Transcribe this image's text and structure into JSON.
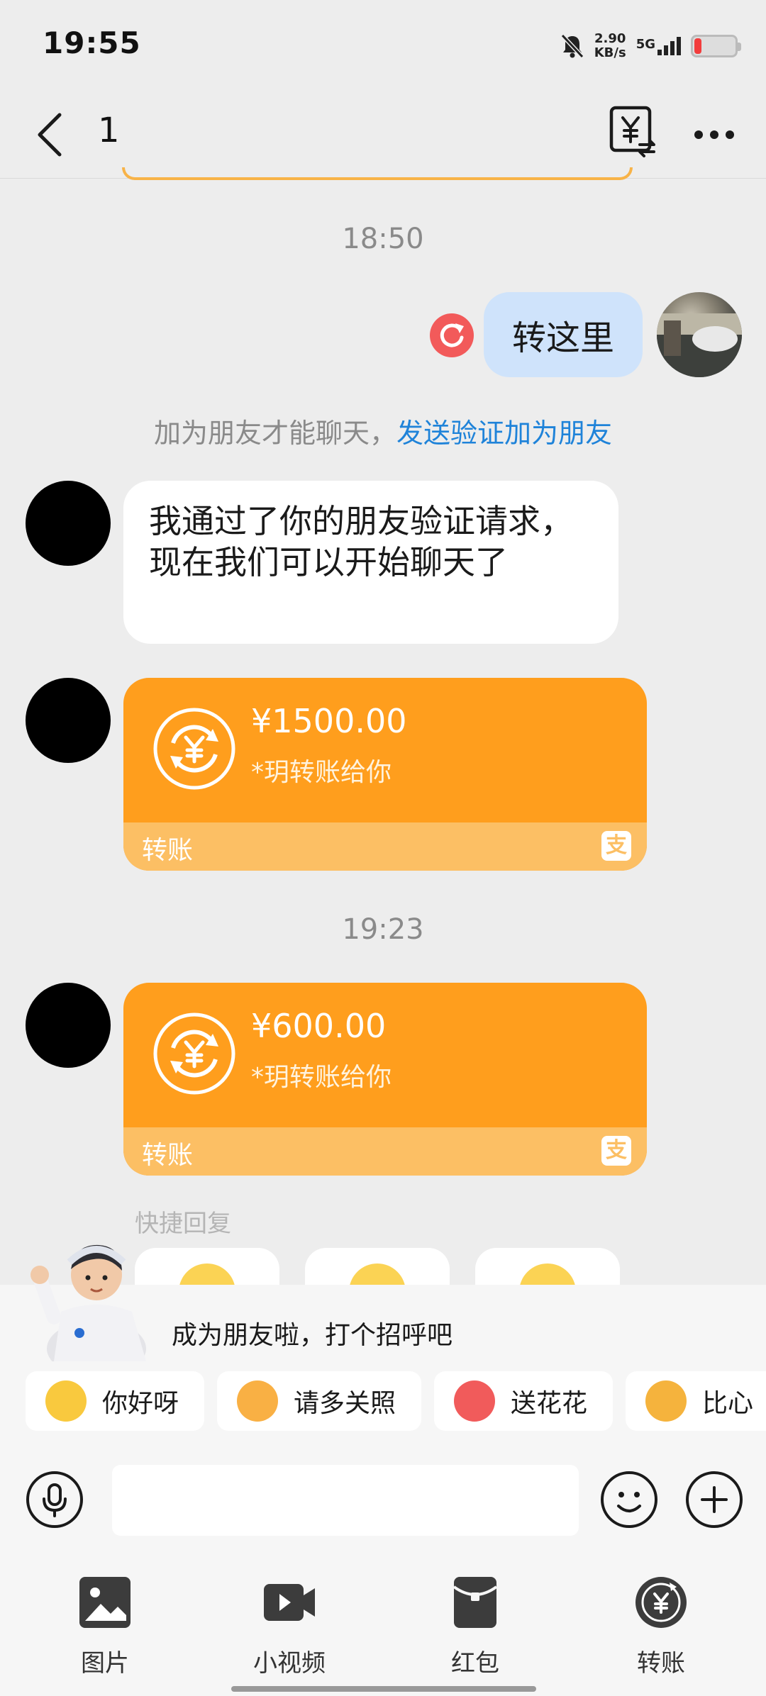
{
  "status_bar": {
    "time": "19:55",
    "speed_value": "2.90",
    "speed_unit": "KB/s",
    "network": "5G"
  },
  "nav": {
    "title": "1",
    "transfer_icon": "yuan-transfer-icon",
    "more_icon": "more-dots-icon"
  },
  "messages": {
    "time_1": "18:50",
    "outgoing_text": "转这里",
    "system_note_prefix": "加为朋友才能聊天，",
    "system_note_link": "发送验证加为朋友",
    "incoming_text": "我通过了你的朋友验证请求，现在我们可以开始聊天了",
    "transfer_1": {
      "amount": "¥1500.00",
      "note": "*玥转账给你",
      "label": "转账"
    },
    "time_2": "19:23",
    "transfer_2": {
      "amount": "¥600.00",
      "note": "*玥转账给你",
      "label": "转账"
    }
  },
  "quick_reply": {
    "title": "快捷回复",
    "greeting": "成为朋友啦，打个招呼吧",
    "chips": [
      "你好呀",
      "请多关照",
      "送花花",
      "比心"
    ]
  },
  "tools": [
    "图片",
    "小视频",
    "红包",
    "转账"
  ],
  "colors": {
    "transfer_orange": "#ff9e1d",
    "transfer_footer": "#fcbf64",
    "outgoing_bubble": "#cfe3fb",
    "link_blue": "#1f83d9",
    "error_red": "#f25a5a"
  }
}
